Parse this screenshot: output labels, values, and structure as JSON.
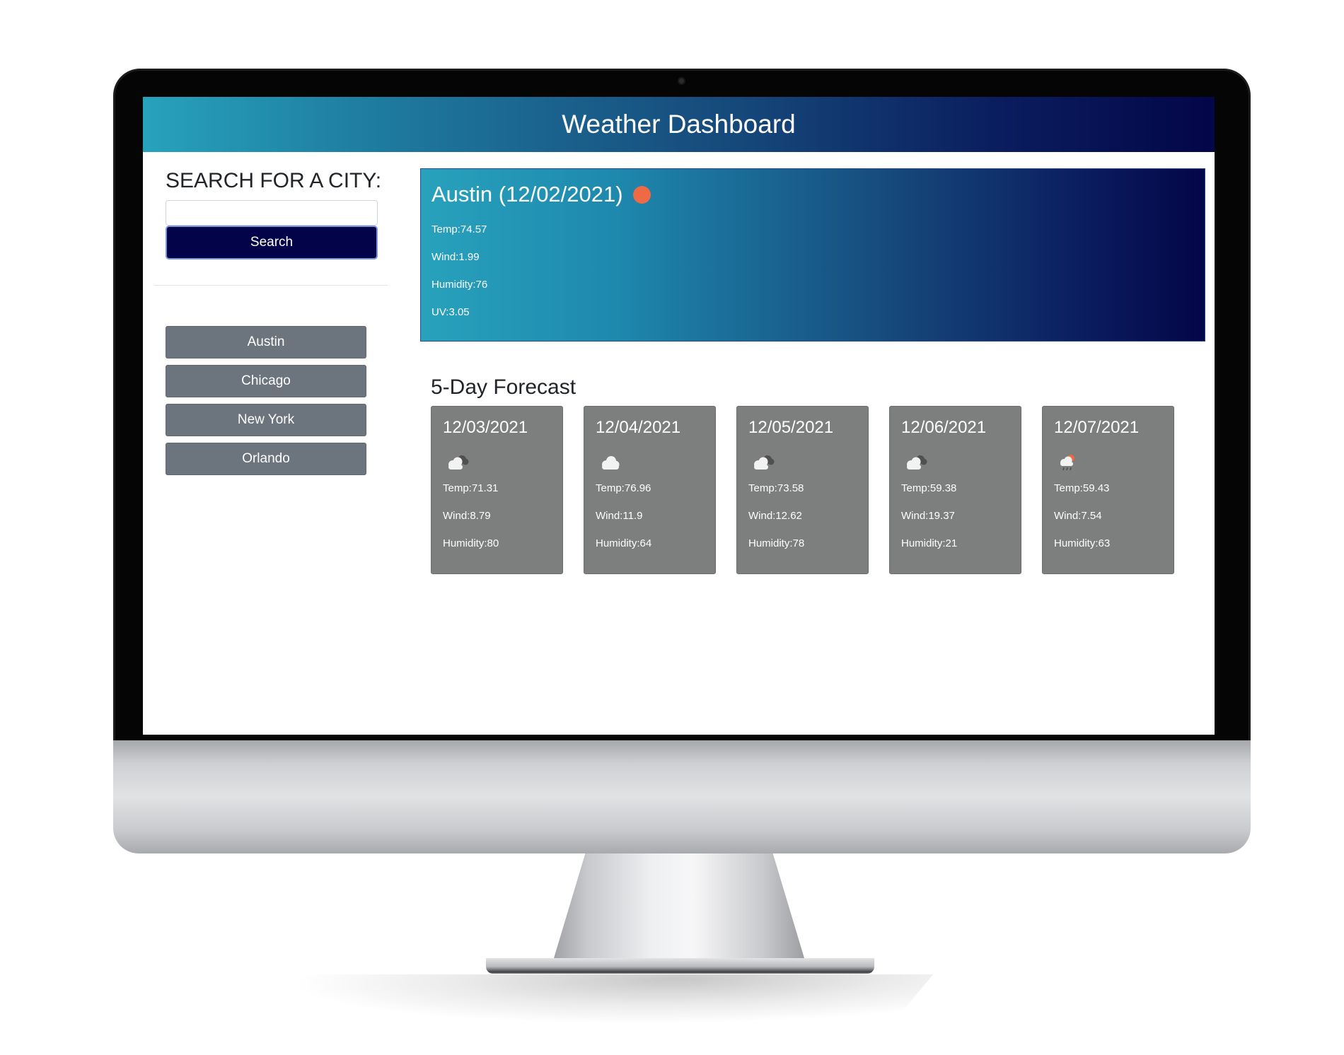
{
  "header": {
    "title": "Weather Dashboard"
  },
  "sidebar": {
    "heading": "SEARCH FOR A CITY:",
    "search_value": "",
    "search_button_label": "Search",
    "cities": [
      {
        "label": "Austin"
      },
      {
        "label": "Chicago"
      },
      {
        "label": "New York"
      },
      {
        "label": "Orlando"
      }
    ]
  },
  "current": {
    "title": "Austin (12/02/2021)",
    "icon": "sun-icon",
    "temp": "Temp:74.57",
    "wind": "Wind:1.99",
    "humidity": "Humidity:76",
    "uv": "UV:3.05"
  },
  "forecast": {
    "heading": "5-Day Forecast",
    "days": [
      {
        "date": "12/03/2021",
        "icon": "broken-clouds-icon",
        "temp": "Temp:71.31",
        "wind": "Wind:8.79",
        "humidity": "Humidity:80"
      },
      {
        "date": "12/04/2021",
        "icon": "cloud-icon",
        "temp": "Temp:76.96",
        "wind": "Wind:11.9",
        "humidity": "Humidity:64"
      },
      {
        "date": "12/05/2021",
        "icon": "broken-clouds-icon",
        "temp": "Temp:73.58",
        "wind": "Wind:12.62",
        "humidity": "Humidity:78"
      },
      {
        "date": "12/06/2021",
        "icon": "broken-clouds-icon",
        "temp": "Temp:59.38",
        "wind": "Wind:19.37",
        "humidity": "Humidity:21"
      },
      {
        "date": "12/07/2021",
        "icon": "rain-icon",
        "temp": "Temp:59.43",
        "wind": "Wind:7.54",
        "humidity": "Humidity:63"
      }
    ]
  },
  "colors": {
    "header_gradient_start": "#27a2bd",
    "header_gradient_end": "#030648",
    "search_button": "#03034a",
    "city_button": "#6c757d",
    "forecast_card": "#7d7e7e",
    "sun": "#ee6a45"
  }
}
